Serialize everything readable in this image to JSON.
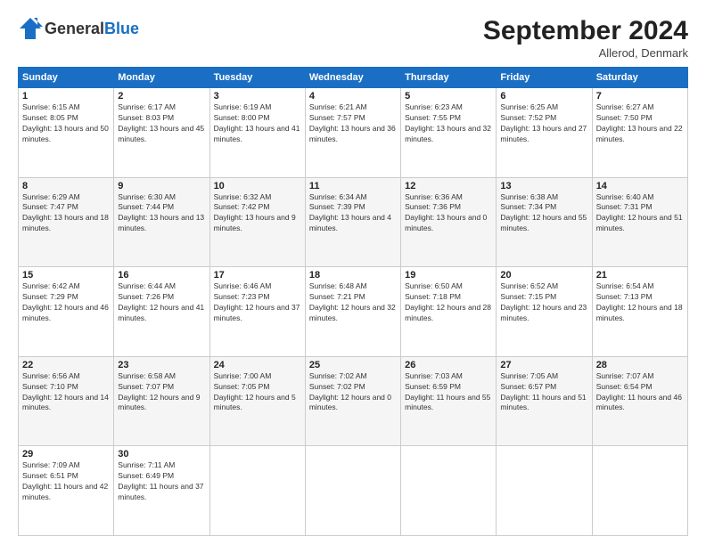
{
  "header": {
    "logo": {
      "general": "General",
      "blue": "Blue"
    },
    "title": "September 2024",
    "location": "Allerod, Denmark"
  },
  "days_of_week": [
    "Sunday",
    "Monday",
    "Tuesday",
    "Wednesday",
    "Thursday",
    "Friday",
    "Saturday"
  ],
  "weeks": [
    [
      {
        "day": "1",
        "sunrise": "Sunrise: 6:15 AM",
        "sunset": "Sunset: 8:05 PM",
        "daylight": "Daylight: 13 hours and 50 minutes."
      },
      {
        "day": "2",
        "sunrise": "Sunrise: 6:17 AM",
        "sunset": "Sunset: 8:03 PM",
        "daylight": "Daylight: 13 hours and 45 minutes."
      },
      {
        "day": "3",
        "sunrise": "Sunrise: 6:19 AM",
        "sunset": "Sunset: 8:00 PM",
        "daylight": "Daylight: 13 hours and 41 minutes."
      },
      {
        "day": "4",
        "sunrise": "Sunrise: 6:21 AM",
        "sunset": "Sunset: 7:57 PM",
        "daylight": "Daylight: 13 hours and 36 minutes."
      },
      {
        "day": "5",
        "sunrise": "Sunrise: 6:23 AM",
        "sunset": "Sunset: 7:55 PM",
        "daylight": "Daylight: 13 hours and 32 minutes."
      },
      {
        "day": "6",
        "sunrise": "Sunrise: 6:25 AM",
        "sunset": "Sunset: 7:52 PM",
        "daylight": "Daylight: 13 hours and 27 minutes."
      },
      {
        "day": "7",
        "sunrise": "Sunrise: 6:27 AM",
        "sunset": "Sunset: 7:50 PM",
        "daylight": "Daylight: 13 hours and 22 minutes."
      }
    ],
    [
      {
        "day": "8",
        "sunrise": "Sunrise: 6:29 AM",
        "sunset": "Sunset: 7:47 PM",
        "daylight": "Daylight: 13 hours and 18 minutes."
      },
      {
        "day": "9",
        "sunrise": "Sunrise: 6:30 AM",
        "sunset": "Sunset: 7:44 PM",
        "daylight": "Daylight: 13 hours and 13 minutes."
      },
      {
        "day": "10",
        "sunrise": "Sunrise: 6:32 AM",
        "sunset": "Sunset: 7:42 PM",
        "daylight": "Daylight: 13 hours and 9 minutes."
      },
      {
        "day": "11",
        "sunrise": "Sunrise: 6:34 AM",
        "sunset": "Sunset: 7:39 PM",
        "daylight": "Daylight: 13 hours and 4 minutes."
      },
      {
        "day": "12",
        "sunrise": "Sunrise: 6:36 AM",
        "sunset": "Sunset: 7:36 PM",
        "daylight": "Daylight: 13 hours and 0 minutes."
      },
      {
        "day": "13",
        "sunrise": "Sunrise: 6:38 AM",
        "sunset": "Sunset: 7:34 PM",
        "daylight": "Daylight: 12 hours and 55 minutes."
      },
      {
        "day": "14",
        "sunrise": "Sunrise: 6:40 AM",
        "sunset": "Sunset: 7:31 PM",
        "daylight": "Daylight: 12 hours and 51 minutes."
      }
    ],
    [
      {
        "day": "15",
        "sunrise": "Sunrise: 6:42 AM",
        "sunset": "Sunset: 7:29 PM",
        "daylight": "Daylight: 12 hours and 46 minutes."
      },
      {
        "day": "16",
        "sunrise": "Sunrise: 6:44 AM",
        "sunset": "Sunset: 7:26 PM",
        "daylight": "Daylight: 12 hours and 41 minutes."
      },
      {
        "day": "17",
        "sunrise": "Sunrise: 6:46 AM",
        "sunset": "Sunset: 7:23 PM",
        "daylight": "Daylight: 12 hours and 37 minutes."
      },
      {
        "day": "18",
        "sunrise": "Sunrise: 6:48 AM",
        "sunset": "Sunset: 7:21 PM",
        "daylight": "Daylight: 12 hours and 32 minutes."
      },
      {
        "day": "19",
        "sunrise": "Sunrise: 6:50 AM",
        "sunset": "Sunset: 7:18 PM",
        "daylight": "Daylight: 12 hours and 28 minutes."
      },
      {
        "day": "20",
        "sunrise": "Sunrise: 6:52 AM",
        "sunset": "Sunset: 7:15 PM",
        "daylight": "Daylight: 12 hours and 23 minutes."
      },
      {
        "day": "21",
        "sunrise": "Sunrise: 6:54 AM",
        "sunset": "Sunset: 7:13 PM",
        "daylight": "Daylight: 12 hours and 18 minutes."
      }
    ],
    [
      {
        "day": "22",
        "sunrise": "Sunrise: 6:56 AM",
        "sunset": "Sunset: 7:10 PM",
        "daylight": "Daylight: 12 hours and 14 minutes."
      },
      {
        "day": "23",
        "sunrise": "Sunrise: 6:58 AM",
        "sunset": "Sunset: 7:07 PM",
        "daylight": "Daylight: 12 hours and 9 minutes."
      },
      {
        "day": "24",
        "sunrise": "Sunrise: 7:00 AM",
        "sunset": "Sunset: 7:05 PM",
        "daylight": "Daylight: 12 hours and 5 minutes."
      },
      {
        "day": "25",
        "sunrise": "Sunrise: 7:02 AM",
        "sunset": "Sunset: 7:02 PM",
        "daylight": "Daylight: 12 hours and 0 minutes."
      },
      {
        "day": "26",
        "sunrise": "Sunrise: 7:03 AM",
        "sunset": "Sunset: 6:59 PM",
        "daylight": "Daylight: 11 hours and 55 minutes."
      },
      {
        "day": "27",
        "sunrise": "Sunrise: 7:05 AM",
        "sunset": "Sunset: 6:57 PM",
        "daylight": "Daylight: 11 hours and 51 minutes."
      },
      {
        "day": "28",
        "sunrise": "Sunrise: 7:07 AM",
        "sunset": "Sunset: 6:54 PM",
        "daylight": "Daylight: 11 hours and 46 minutes."
      }
    ],
    [
      {
        "day": "29",
        "sunrise": "Sunrise: 7:09 AM",
        "sunset": "Sunset: 6:51 PM",
        "daylight": "Daylight: 11 hours and 42 minutes."
      },
      {
        "day": "30",
        "sunrise": "Sunrise: 7:11 AM",
        "sunset": "Sunset: 6:49 PM",
        "daylight": "Daylight: 11 hours and 37 minutes."
      },
      null,
      null,
      null,
      null,
      null
    ]
  ]
}
